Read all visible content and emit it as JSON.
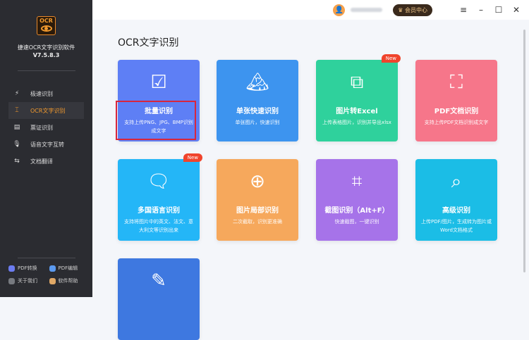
{
  "app": {
    "logo_text": "OCR",
    "name": "捷速OCR文字识别软件",
    "version": "V7.5.8.3"
  },
  "sidebar": {
    "items": [
      {
        "label": "极速识别",
        "icon": "lightning-doc-icon",
        "active": false
      },
      {
        "label": "OCR文字识别",
        "icon": "text-scan-icon",
        "active": true
      },
      {
        "label": "票证识别",
        "icon": "ticket-icon",
        "active": false
      },
      {
        "label": "语音文字互转",
        "icon": "microphone-icon",
        "active": false
      },
      {
        "label": "文档翻译",
        "icon": "translate-doc-icon",
        "active": false
      }
    ],
    "bottom": [
      {
        "label": "PDF转换",
        "color": "#6c7cf0"
      },
      {
        "label": "PDF编辑",
        "color": "#5b9af0"
      },
      {
        "label": "关于我们",
        "color": "#777a80"
      },
      {
        "label": "软件帮助",
        "color": "#e0a866"
      }
    ]
  },
  "topbar": {
    "vip_label": "会员中心",
    "menu": "≡",
    "minimize": "–",
    "maximize": "☐",
    "close": "✕"
  },
  "main": {
    "title": "OCR文字识别",
    "new_badge": "New",
    "cards": [
      {
        "name": "批量识别",
        "desc": "支持上传PNG、JPG、BMP识别成文字",
        "color": "#5e7ff5",
        "icon": "☑",
        "new": false
      },
      {
        "name": "单张快速识别",
        "desc": "单张图片，快速识别",
        "color": "#3d94ef",
        "icon": "🏔",
        "new": false
      },
      {
        "name": "图片转Excel",
        "desc": "上传表格图片，识别并导出xlsx",
        "color": "#2fd19c",
        "icon": "⧉",
        "new": true
      },
      {
        "name": "PDF文档识别",
        "desc": "支持上传PDF文档识别成文字",
        "color": "#f6768a",
        "icon": "⛶",
        "new": false
      },
      {
        "name": "多国语言识别",
        "desc": "支持将图片中的英文、法文、意大利文等识别出来",
        "color": "#24b6f7",
        "icon": "🗨",
        "new": true
      },
      {
        "name": "图片局部识别",
        "desc": "二次截取，识别更准确",
        "color": "#f6a85c",
        "icon": "⊕",
        "new": false
      },
      {
        "name": "截图识别（Alt+F）",
        "desc": "快速截图，一键识别",
        "color": "#a673e9",
        "icon": "⌗",
        "new": false
      },
      {
        "name": "高级识别",
        "desc": "上传PDF/图片，生成转为图片或Word文档格式",
        "color": "#1bbde6",
        "icon": "⌕",
        "new": false
      },
      {
        "name": "",
        "desc": "",
        "color": "#3e78e0",
        "icon": "✎",
        "new": false
      }
    ]
  }
}
